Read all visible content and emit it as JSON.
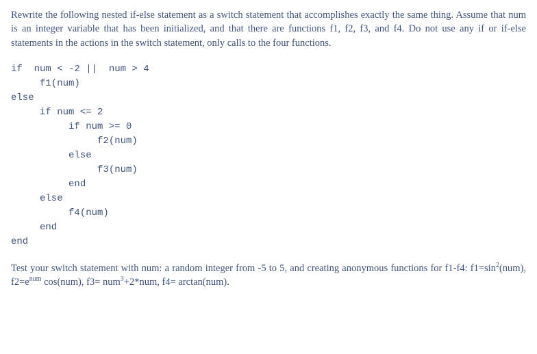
{
  "para1": {
    "text_parts": [
      "Rewrite the following nested if-else statement as a switch statement that accomplishes exactly the same thing. Assume that num is an integer variable that has been initialized, and that there are functions f1, f2, f3, and f4. Do not use any if or if-else statements in the actions in the switch statement, only calls to the four functions."
    ]
  },
  "code": {
    "lines": [
      "if  num < -2 ||  num > 4",
      "     f1(num)",
      "else",
      "     if num <= 2",
      "          if num >= 0",
      "               f2(num)",
      "          else",
      "               f3(num)",
      "          end",
      "     else",
      "          f4(num)",
      "     end",
      "end"
    ]
  },
  "para2": {
    "prefix": "Test your switch statement with num: a random integer from -5 to 5, and creating anonymous functions for f1-f4: f1=sin",
    "sup1": "2",
    "mid1": "(num), f2=e",
    "sup2": "num",
    "mid2": " cos(num), f3= num",
    "sup3": "3",
    "suffix": "+2*num, f4= arctan(num)."
  }
}
